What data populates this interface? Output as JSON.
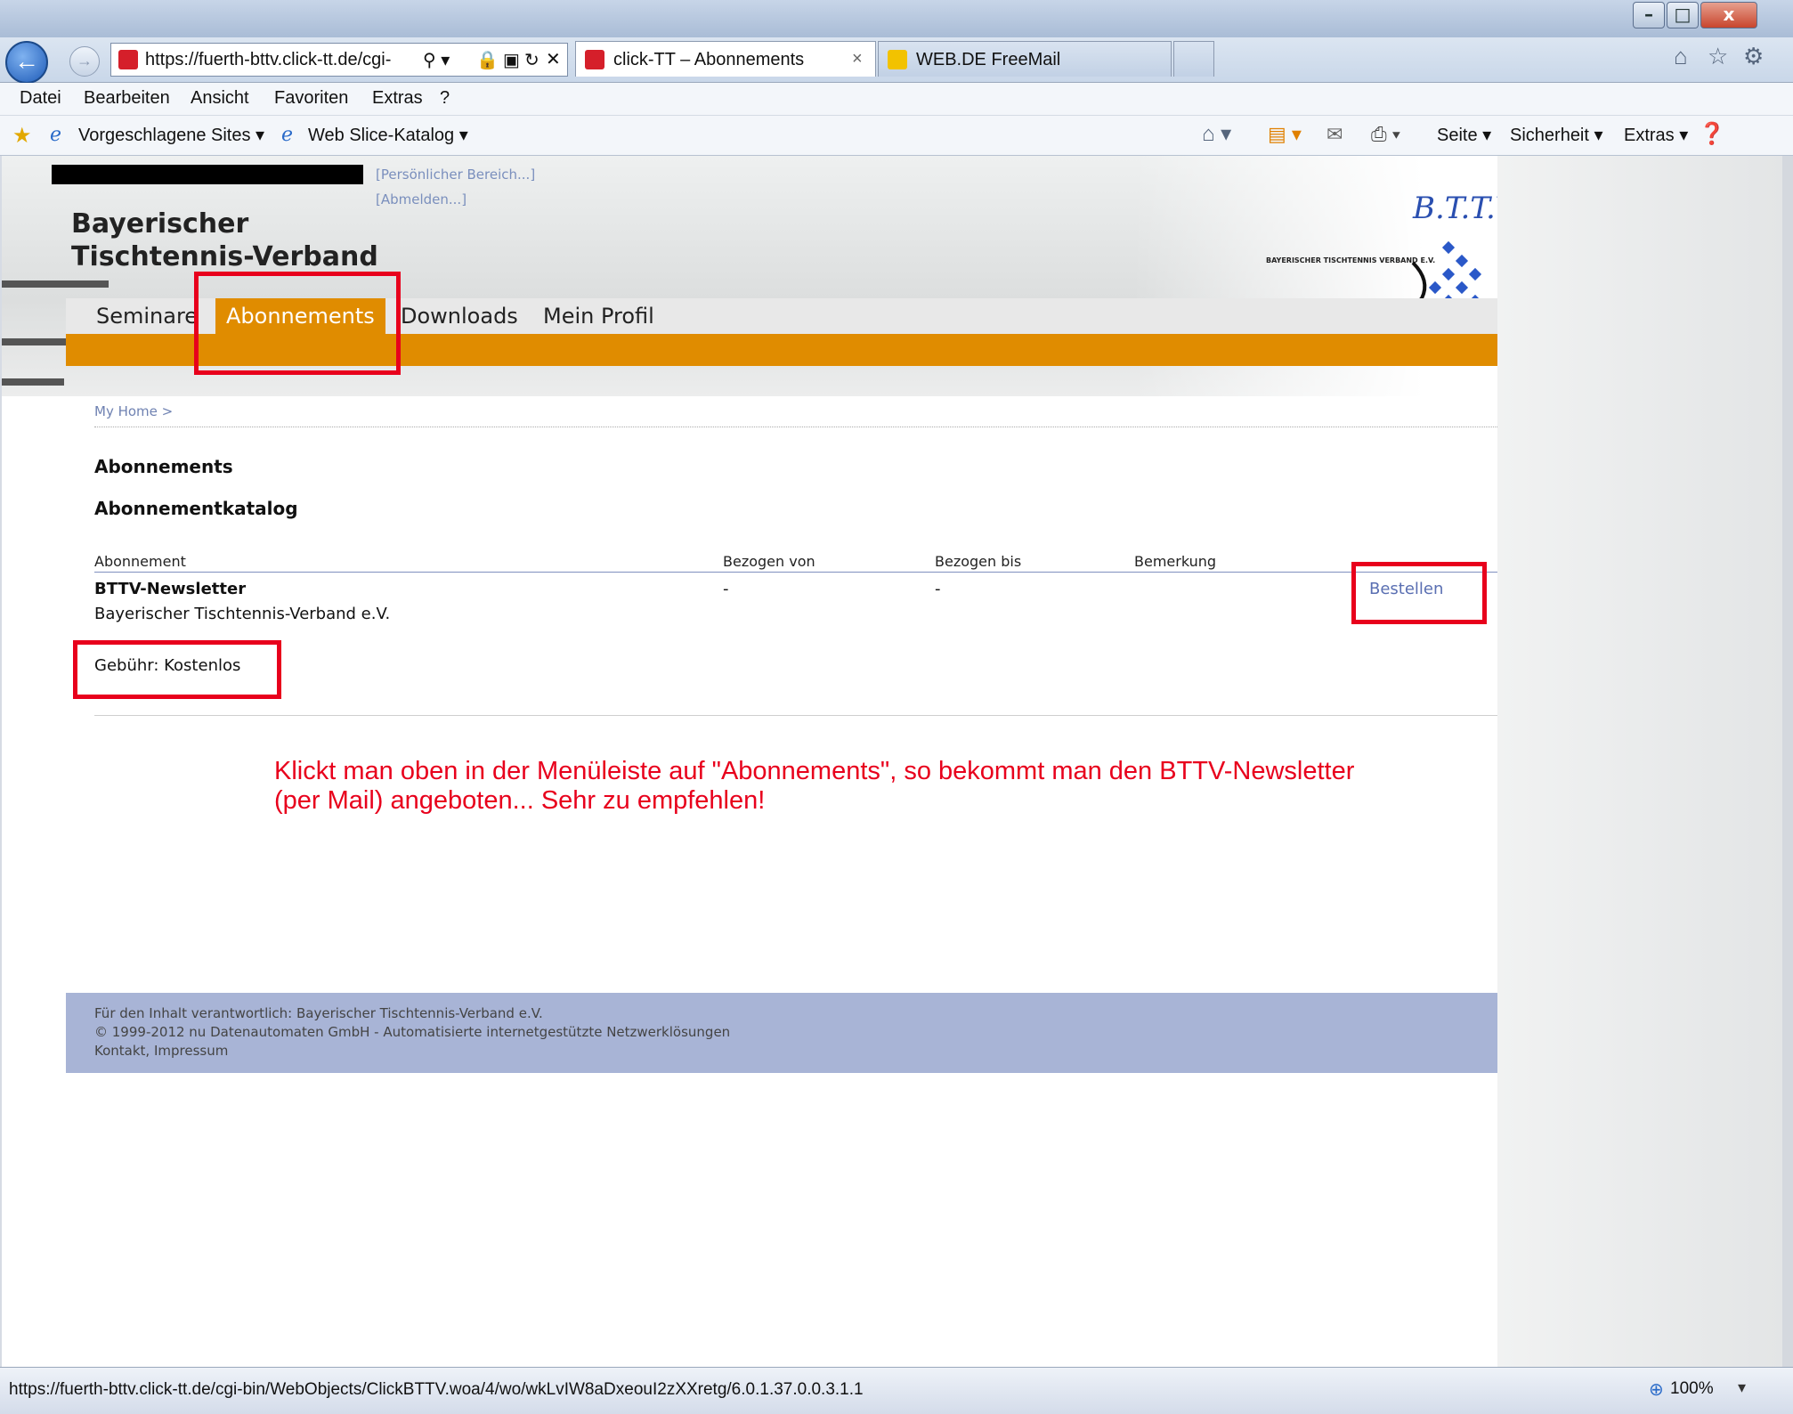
{
  "browser": {
    "url": "https://fuerth-bttv.click-tt.de/cgi-",
    "tabs": [
      {
        "title": "click-TT – Abonnements",
        "close": "×"
      },
      {
        "title": "WEB.DE FreeMail"
      }
    ],
    "menu": [
      "Datei",
      "Bearbeiten",
      "Ansicht",
      "Favoriten",
      "Extras",
      "?"
    ],
    "favorites": [
      {
        "label": "Vorgeschlagene Sites ▾"
      },
      {
        "label": "Web Slice-Katalog ▾"
      }
    ],
    "command_bar": [
      "Seite ▾",
      "Sicherheit ▾",
      "Extras ▾"
    ],
    "status_url": "https://fuerth-bttv.click-tt.de/cgi-bin/WebObjects/ClickBTTV.woa/4/wo/wkLvIW8aDxeouI2zXXretg/6.0.1.37.0.0.3.1.1",
    "zoom": "100%"
  },
  "site": {
    "top_links": [
      "[Persönlicher Bereich...]",
      "[Abmelden...]"
    ],
    "org_line1": "Bayerischer",
    "org_line2": "Tischtennis-Verband",
    "logo_text": "BAYERISCHER TISCHTENNIS VERBAND E.V.",
    "logo_letters": "B.T.T.V.",
    "nav": [
      "Seminare",
      "Abonnements",
      "Downloads",
      "Mein Profil"
    ],
    "nav_active": "Abonnements"
  },
  "page": {
    "breadcrumb": "My Home >",
    "heading": "Abonnements",
    "subheading": "Abonnementkatalog",
    "columns": [
      "Abonnement",
      "Bezogen von",
      "Bezogen bis",
      "Bemerkung"
    ],
    "row": {
      "name": "BTTV-Newsletter",
      "publisher": "Bayerischer Tischtennis-Verband e.V.",
      "from": "-",
      "to": "-",
      "action": "Bestellen",
      "fee": "Gebühr: Kostenlos"
    },
    "note": "Klickt man oben in der Menüleiste auf \"Abonnements\", so bekommt man den BTTV-Newsletter (per Mail) angeboten... Sehr zu empfehlen!"
  },
  "footer": {
    "line1": "Für den Inhalt verantwortlich: Bayerischer Tischtennis-Verband e.V.",
    "line2": "© 1999-2012 nu Datenautomaten GmbH - Automatisierte internetgestützte Netzwerklösungen",
    "line3": "Kontakt, Impressum"
  },
  "colors": {
    "accent": "#e08c00",
    "annotation": "#e8001c",
    "footer": "#a8b4d6"
  }
}
